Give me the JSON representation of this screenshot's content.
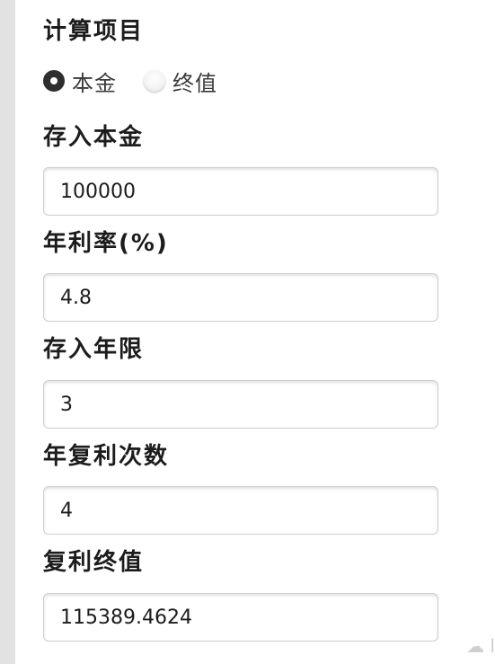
{
  "calc_item": {
    "title": "计算项目",
    "options": [
      {
        "label": "本金",
        "checked": true
      },
      {
        "label": "终值",
        "checked": false
      }
    ]
  },
  "fields": [
    {
      "label": "存入本金",
      "value": "100000"
    },
    {
      "label": "年利率(%)",
      "value": "4.8"
    },
    {
      "label": "存入年限",
      "value": "3"
    },
    {
      "label": "年复利次数",
      "value": "4"
    },
    {
      "label": "复利终值",
      "value": "115389.4624"
    }
  ],
  "watermark": "☁ l"
}
